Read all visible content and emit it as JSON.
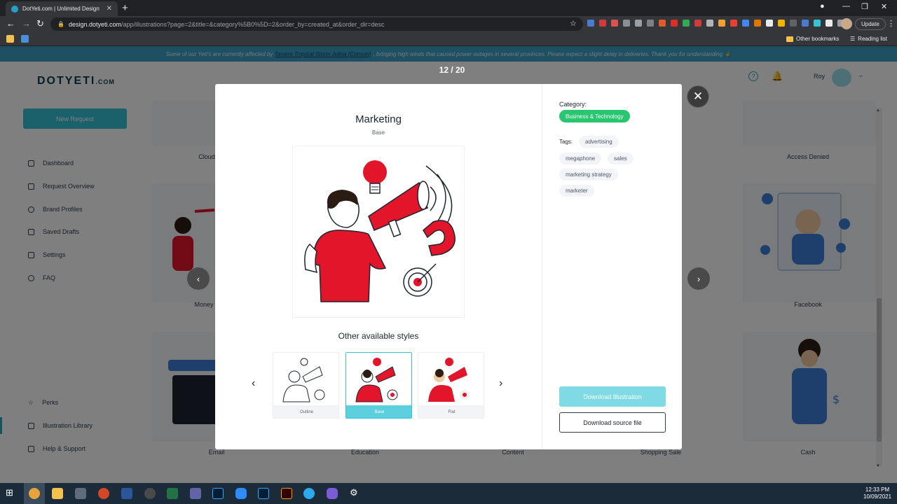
{
  "browser": {
    "tab_title": "DotYeti.com | Unlimited Design",
    "url_host": "design.dotyeti.com",
    "url_path": "/app/illustrations?page=2&title=&category%5B0%5D=2&order_by=created_at&order_dir=desc",
    "update_label": "Update",
    "bookmark_other": "Other bookmarks",
    "bookmark_reading": "Reading list"
  },
  "notice": {
    "text_before": "Some of our Yeti's are currently affected by",
    "link": "Severe Tropical Storm Jolina (Conson)",
    "text_after": ", bringing high winds that caused power outages in several provinces. Please expect a slight delay in deliveries. Thank you for understanding 🙏"
  },
  "logo": {
    "main": "DOTYETI",
    "tld": ".COM"
  },
  "sidebar": {
    "new_request": "New Request",
    "items": [
      {
        "label": "Dashboard",
        "icon": "dashboard-icon"
      },
      {
        "label": "Request Overview",
        "icon": "list-icon"
      },
      {
        "label": "Brand Profiles",
        "icon": "user-icon"
      },
      {
        "label": "Saved Drafts",
        "icon": "drafts-icon"
      },
      {
        "label": "Settings",
        "icon": "settings-icon"
      },
      {
        "label": "FAQ",
        "icon": "help-icon"
      }
    ],
    "bottom_items": [
      {
        "label": "Perks",
        "icon": "star-icon"
      },
      {
        "label": "Illustration Library",
        "icon": "image-icon"
      },
      {
        "label": "Help & Support",
        "icon": "chat-icon"
      }
    ]
  },
  "header": {
    "username": "Roy"
  },
  "grid_labels": {
    "row1": [
      "Cloud",
      "Access Denied"
    ],
    "row2": [
      "Money",
      "Facebook"
    ],
    "row3": [
      "Email",
      "Education",
      "Content",
      "Shopping Sale",
      "Cash"
    ]
  },
  "modal": {
    "counter": "12 / 20",
    "title": "Marketing",
    "style_name": "Base",
    "other_styles_title": "Other available styles",
    "styles": [
      "Outline",
      "Base",
      "Flat"
    ],
    "category_label": "Category:",
    "category": "Business & Technology",
    "tags_label": "Tags:",
    "tags": [
      "advertising",
      "megaphone",
      "sales",
      "marketing strategy",
      "marketer"
    ],
    "download_label": "Download Illustration",
    "source_label": "Download source file"
  },
  "taskbar": {
    "time": "12:33 PM",
    "date": "10/09/2021"
  },
  "colors": {
    "accent": "#35c3d6",
    "category_badge": "#28c76f",
    "illustration_red": "#e3152b"
  }
}
